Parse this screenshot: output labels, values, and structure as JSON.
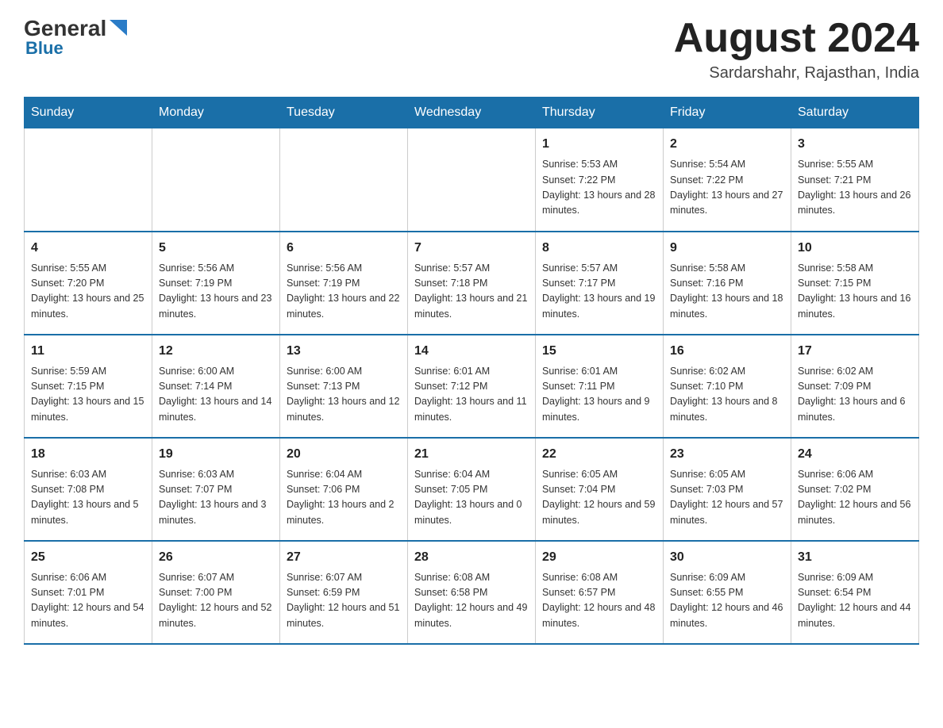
{
  "header": {
    "logo_general": "General",
    "logo_blue": "Blue",
    "month_title": "August 2024",
    "location": "Sardarshahr, Rajasthan, India"
  },
  "days_of_week": [
    "Sunday",
    "Monday",
    "Tuesday",
    "Wednesday",
    "Thursday",
    "Friday",
    "Saturday"
  ],
  "weeks": [
    [
      {
        "day": "",
        "info": ""
      },
      {
        "day": "",
        "info": ""
      },
      {
        "day": "",
        "info": ""
      },
      {
        "day": "",
        "info": ""
      },
      {
        "day": "1",
        "info": "Sunrise: 5:53 AM\nSunset: 7:22 PM\nDaylight: 13 hours and 28 minutes."
      },
      {
        "day": "2",
        "info": "Sunrise: 5:54 AM\nSunset: 7:22 PM\nDaylight: 13 hours and 27 minutes."
      },
      {
        "day": "3",
        "info": "Sunrise: 5:55 AM\nSunset: 7:21 PM\nDaylight: 13 hours and 26 minutes."
      }
    ],
    [
      {
        "day": "4",
        "info": "Sunrise: 5:55 AM\nSunset: 7:20 PM\nDaylight: 13 hours and 25 minutes."
      },
      {
        "day": "5",
        "info": "Sunrise: 5:56 AM\nSunset: 7:19 PM\nDaylight: 13 hours and 23 minutes."
      },
      {
        "day": "6",
        "info": "Sunrise: 5:56 AM\nSunset: 7:19 PM\nDaylight: 13 hours and 22 minutes."
      },
      {
        "day": "7",
        "info": "Sunrise: 5:57 AM\nSunset: 7:18 PM\nDaylight: 13 hours and 21 minutes."
      },
      {
        "day": "8",
        "info": "Sunrise: 5:57 AM\nSunset: 7:17 PM\nDaylight: 13 hours and 19 minutes."
      },
      {
        "day": "9",
        "info": "Sunrise: 5:58 AM\nSunset: 7:16 PM\nDaylight: 13 hours and 18 minutes."
      },
      {
        "day": "10",
        "info": "Sunrise: 5:58 AM\nSunset: 7:15 PM\nDaylight: 13 hours and 16 minutes."
      }
    ],
    [
      {
        "day": "11",
        "info": "Sunrise: 5:59 AM\nSunset: 7:15 PM\nDaylight: 13 hours and 15 minutes."
      },
      {
        "day": "12",
        "info": "Sunrise: 6:00 AM\nSunset: 7:14 PM\nDaylight: 13 hours and 14 minutes."
      },
      {
        "day": "13",
        "info": "Sunrise: 6:00 AM\nSunset: 7:13 PM\nDaylight: 13 hours and 12 minutes."
      },
      {
        "day": "14",
        "info": "Sunrise: 6:01 AM\nSunset: 7:12 PM\nDaylight: 13 hours and 11 minutes."
      },
      {
        "day": "15",
        "info": "Sunrise: 6:01 AM\nSunset: 7:11 PM\nDaylight: 13 hours and 9 minutes."
      },
      {
        "day": "16",
        "info": "Sunrise: 6:02 AM\nSunset: 7:10 PM\nDaylight: 13 hours and 8 minutes."
      },
      {
        "day": "17",
        "info": "Sunrise: 6:02 AM\nSunset: 7:09 PM\nDaylight: 13 hours and 6 minutes."
      }
    ],
    [
      {
        "day": "18",
        "info": "Sunrise: 6:03 AM\nSunset: 7:08 PM\nDaylight: 13 hours and 5 minutes."
      },
      {
        "day": "19",
        "info": "Sunrise: 6:03 AM\nSunset: 7:07 PM\nDaylight: 13 hours and 3 minutes."
      },
      {
        "day": "20",
        "info": "Sunrise: 6:04 AM\nSunset: 7:06 PM\nDaylight: 13 hours and 2 minutes."
      },
      {
        "day": "21",
        "info": "Sunrise: 6:04 AM\nSunset: 7:05 PM\nDaylight: 13 hours and 0 minutes."
      },
      {
        "day": "22",
        "info": "Sunrise: 6:05 AM\nSunset: 7:04 PM\nDaylight: 12 hours and 59 minutes."
      },
      {
        "day": "23",
        "info": "Sunrise: 6:05 AM\nSunset: 7:03 PM\nDaylight: 12 hours and 57 minutes."
      },
      {
        "day": "24",
        "info": "Sunrise: 6:06 AM\nSunset: 7:02 PM\nDaylight: 12 hours and 56 minutes."
      }
    ],
    [
      {
        "day": "25",
        "info": "Sunrise: 6:06 AM\nSunset: 7:01 PM\nDaylight: 12 hours and 54 minutes."
      },
      {
        "day": "26",
        "info": "Sunrise: 6:07 AM\nSunset: 7:00 PM\nDaylight: 12 hours and 52 minutes."
      },
      {
        "day": "27",
        "info": "Sunrise: 6:07 AM\nSunset: 6:59 PM\nDaylight: 12 hours and 51 minutes."
      },
      {
        "day": "28",
        "info": "Sunrise: 6:08 AM\nSunset: 6:58 PM\nDaylight: 12 hours and 49 minutes."
      },
      {
        "day": "29",
        "info": "Sunrise: 6:08 AM\nSunset: 6:57 PM\nDaylight: 12 hours and 48 minutes."
      },
      {
        "day": "30",
        "info": "Sunrise: 6:09 AM\nSunset: 6:55 PM\nDaylight: 12 hours and 46 minutes."
      },
      {
        "day": "31",
        "info": "Sunrise: 6:09 AM\nSunset: 6:54 PM\nDaylight: 12 hours and 44 minutes."
      }
    ]
  ]
}
